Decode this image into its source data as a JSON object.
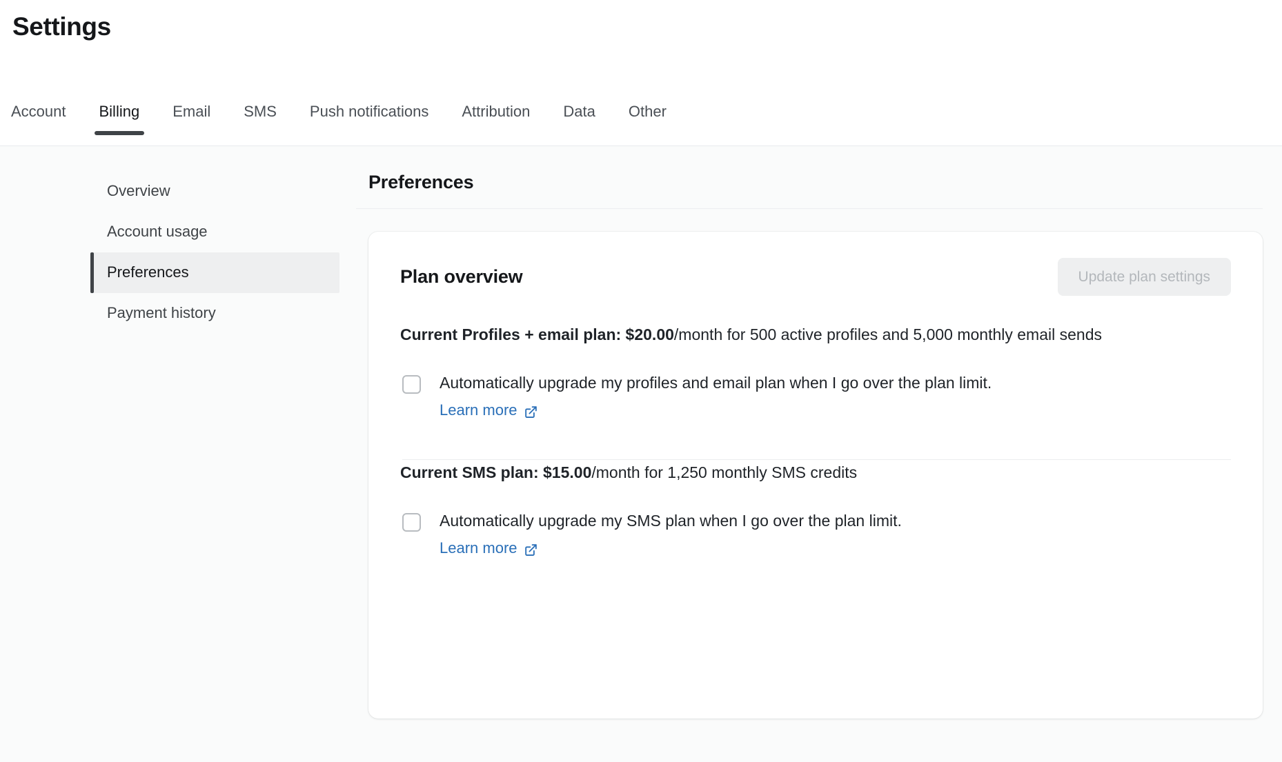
{
  "header": {
    "title": "Settings"
  },
  "tabs": [
    {
      "label": "Account",
      "active": false
    },
    {
      "label": "Billing",
      "active": true
    },
    {
      "label": "Email",
      "active": false
    },
    {
      "label": "SMS",
      "active": false
    },
    {
      "label": "Push notifications",
      "active": false
    },
    {
      "label": "Attribution",
      "active": false
    },
    {
      "label": "Data",
      "active": false
    },
    {
      "label": "Other",
      "active": false
    }
  ],
  "sidebar": {
    "items": [
      {
        "label": "Overview",
        "active": false
      },
      {
        "label": "Account usage",
        "active": false
      },
      {
        "label": "Preferences",
        "active": true
      },
      {
        "label": "Payment history",
        "active": false
      }
    ]
  },
  "main": {
    "section_title": "Preferences",
    "card": {
      "title": "Plan overview",
      "update_button_label": "Update plan settings",
      "update_button_disabled": true,
      "email_plan": {
        "label_strong": "Current Profiles + email plan: $20.00",
        "label_rest": "/month for 500 active profiles and 5,000 monthly email sends",
        "price": "$20.00",
        "active_profiles": "500",
        "monthly_email_sends": "5,000",
        "checkbox_label": "Automatically upgrade my profiles and email plan when I go over the plan limit.",
        "checkbox_checked": false,
        "learn_more_label": "Learn more",
        "learn_more_icon": "external-link-icon"
      },
      "sms_plan": {
        "label_strong": "Current SMS plan: $15.00",
        "label_rest": "/month for 1,250 monthly SMS credits",
        "price": "$15.00",
        "monthly_sms_credits": "1,250",
        "checkbox_label": "Automatically upgrade my SMS plan when I go over the plan limit.",
        "checkbox_checked": false,
        "learn_more_label": "Learn more",
        "learn_more_icon": "external-link-icon"
      }
    }
  },
  "colors": {
    "link": "#2a6fb8",
    "active_underline": "#3f4347",
    "page_bg": "#fafbfb",
    "card_bg": "#ffffff",
    "disabled_button_bg": "#eeeff0",
    "disabled_button_text": "#b3b7bb",
    "sidebar_active_bg": "#eeeff0"
  }
}
